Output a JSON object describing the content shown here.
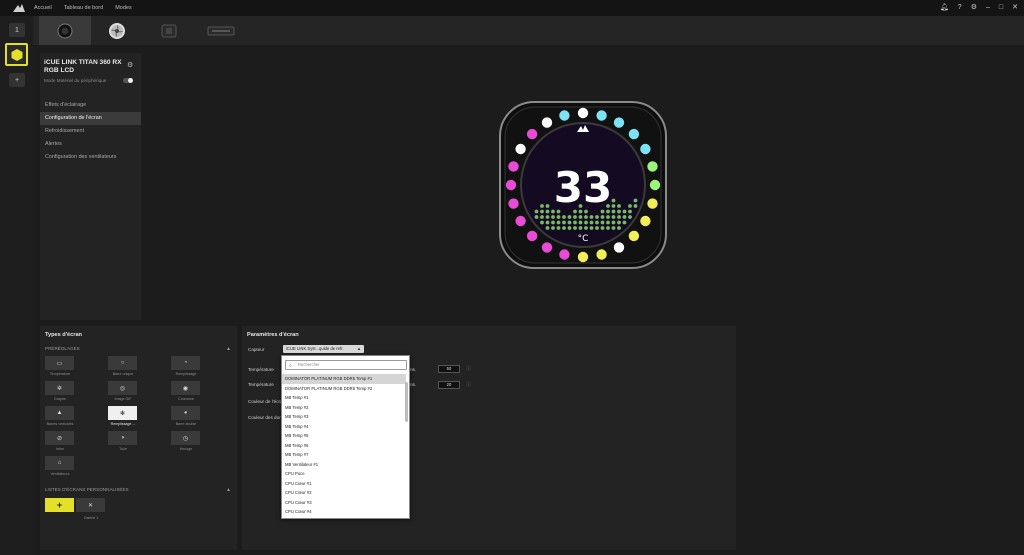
{
  "topbar": {
    "nav": [
      "Accueil",
      "Tableau de bord",
      "Modes"
    ],
    "right_icons": [
      "bell-icon",
      "help-icon",
      "settings-icon"
    ],
    "window_controls": [
      "–",
      "□",
      "✕"
    ]
  },
  "rail": {
    "top_label": "1",
    "add_label": "+"
  },
  "device_panel": {
    "name": "iCUE LINK TITAN 360 RX RGB LCD",
    "mode_label": "Mode Matériel du périphérique",
    "menu": [
      "Effets d'éclairage",
      "Configuration de l'écran",
      "Refroidissement",
      "Alertes",
      "Configuration des ventilateurs"
    ]
  },
  "lcd": {
    "value": "33",
    "unit": "°C"
  },
  "types": {
    "title": "Types d'écran",
    "presets_label": "PRÉRÉGLAGES",
    "tiles": [
      {
        "label": "Température",
        "glyph": "▭"
      },
      {
        "label": "Barre unique",
        "glyph": "○"
      },
      {
        "label": "Remplissage",
        "glyph": "◔"
      },
      {
        "label": "Graphe",
        "glyph": "✲"
      },
      {
        "label": "Image GIF",
        "glyph": "◎"
      },
      {
        "label": "Couronne",
        "glyph": "◉"
      },
      {
        "label": "Barres verticales",
        "glyph": "▲"
      },
      {
        "label": "Remplissage ...",
        "glyph": "✻"
      },
      {
        "label": "Barre double",
        "glyph": "◕"
      },
      {
        "label": "Infos",
        "glyph": "⊘"
      },
      {
        "label": "Tuile",
        "glyph": "◑"
      },
      {
        "label": "Horloge",
        "glyph": "◷"
      },
      {
        "label": "Ventilateurs",
        "glyph": "⌂"
      }
    ],
    "custom_label": "LISTES D'ÉCRANS PERSONNALISÉES",
    "custom_add": "+",
    "custom_item_label": "Galerie 1",
    "custom_item_glyph": "✕"
  },
  "params": {
    "title": "Paramètres d'écran",
    "sensor_label": "Capteur",
    "sensor_value": "iCUE LINK Syst...quide de refr.",
    "temp_low_label": "Température",
    "temp_high_label": "Température",
    "color_label_1": "Couleur de l'écran",
    "color_label_2": "Couleur des données",
    "temp_low_value": "50",
    "temp_high_value": "20",
    "tail_text_1": "ns.",
    "tail_text_2": "ns."
  },
  "dropdown": {
    "search_placeholder": "Rechercher",
    "items": [
      "DOMINATOR PLATINUM RGB DDR5 Temp #1",
      "DOMINATOR PLATINUM RGB DDR5 Temp #2",
      "MB Temp #1",
      "MB Temp #2",
      "MB Temp #3",
      "MB Temp #4",
      "MB Temp #5",
      "MB Temp #6",
      "MB Temp #7",
      "MB Ventilateur #1",
      "CPU Puce",
      "CPU Cœur #1",
      "CPU Cœur #2",
      "CPU Cœur #3",
      "CPU Cœur #4"
    ]
  },
  "colors": {
    "accent_yellow": "#e4e029",
    "lcd_bg": "#140b22",
    "led_cyan": "#7de3f4",
    "led_magenta": "#e94ad6",
    "led_yellow": "#f2ee5a",
    "led_green": "#9af57a",
    "led_white": "#ffffff"
  }
}
